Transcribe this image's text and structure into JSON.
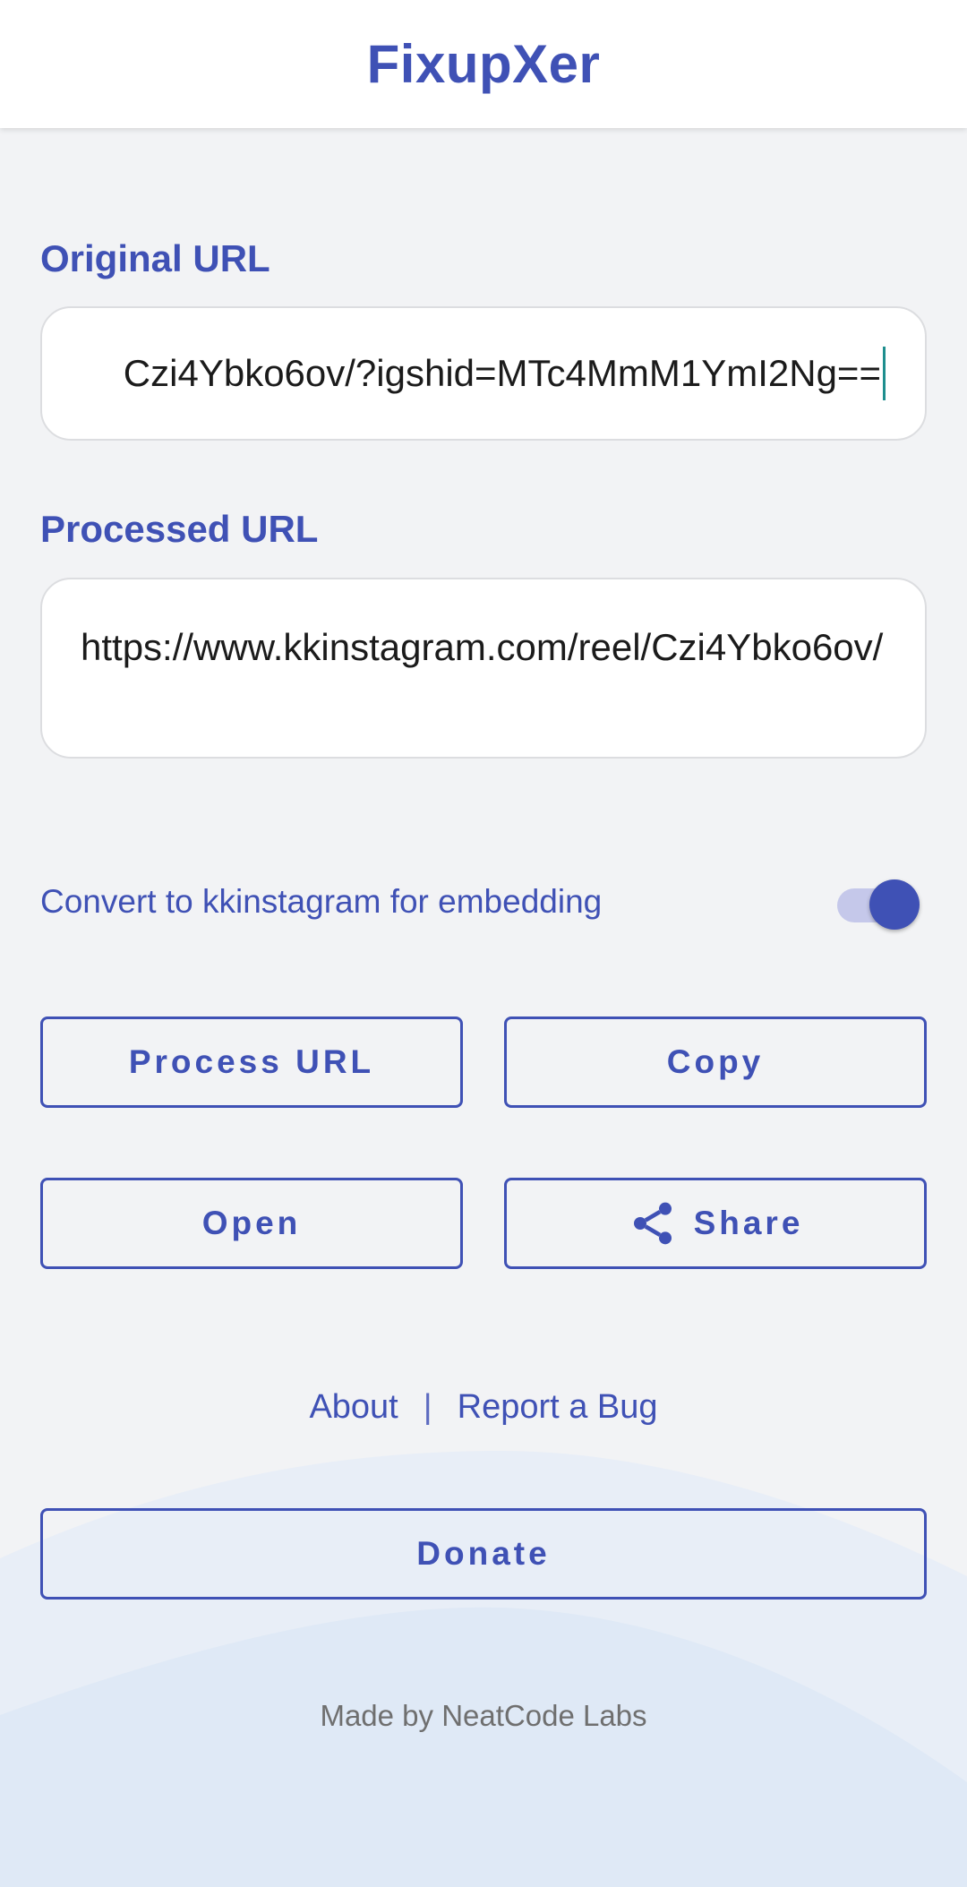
{
  "app": {
    "title": "FixupXer"
  },
  "original": {
    "label": "Original URL",
    "value": "Czi4Ybko6ov/?igshid=MTc4MmM1YmI2Ng=="
  },
  "processed": {
    "label": "Processed URL",
    "value": "https://www.kkinstagram.com/reel/Czi4Ybko6ov/"
  },
  "toggle": {
    "label": "Convert to kkinstagram for embedding",
    "enabled": true
  },
  "buttons": {
    "process": "Process URL",
    "copy": "Copy",
    "open": "Open",
    "share": "Share",
    "donate": "Donate"
  },
  "links": {
    "about": "About",
    "separator": "|",
    "report": "Report a Bug"
  },
  "footer": {
    "text": "Made by NeatCode Labs"
  },
  "colors": {
    "accent": "#3f51b5",
    "background": "#f2f3f5",
    "caret": "#1e8e8e"
  },
  "icons": {
    "share": "share-icon"
  }
}
